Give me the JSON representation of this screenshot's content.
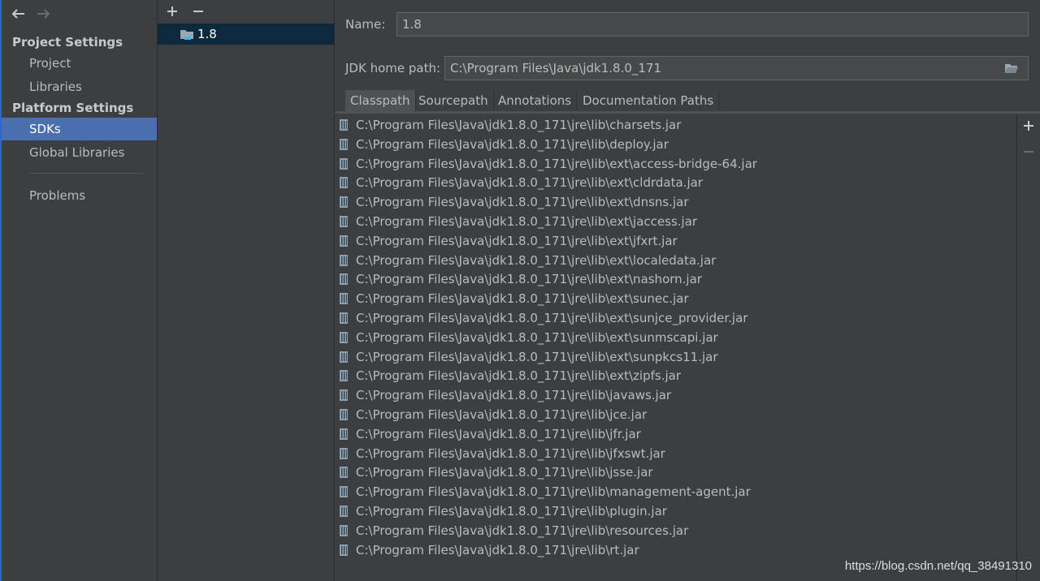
{
  "nav": {
    "back_icon": "back-arrow-icon",
    "forward_icon": "forward-arrow-icon",
    "project_settings_header": "Project Settings",
    "project_label": "Project",
    "libraries_label": "Libraries",
    "platform_settings_header": "Platform Settings",
    "sdks_label": "SDKs",
    "global_libraries_label": "Global Libraries",
    "problems_label": "Problems"
  },
  "sdk_list": {
    "add_icon": "plus-icon",
    "remove_icon": "minus-icon",
    "items": [
      {
        "label": "1.8",
        "icon": "sdk-folder-icon"
      }
    ]
  },
  "detail": {
    "name_label": "Name:",
    "name_value": "1.8",
    "jdk_home_label": "JDK home path:",
    "jdk_home_value": "C:\\Program Files\\Java\\jdk1.8.0_171",
    "browse_icon": "folder-open-icon",
    "tabs": [
      {
        "label": "Classpath",
        "active": true
      },
      {
        "label": "Sourcepath",
        "active": false
      },
      {
        "label": "Annotations",
        "active": false
      },
      {
        "label": "Documentation Paths",
        "active": false
      }
    ],
    "classpath": [
      "C:\\Program Files\\Java\\jdk1.8.0_171\\jre\\lib\\charsets.jar",
      "C:\\Program Files\\Java\\jdk1.8.0_171\\jre\\lib\\deploy.jar",
      "C:\\Program Files\\Java\\jdk1.8.0_171\\jre\\lib\\ext\\access-bridge-64.jar",
      "C:\\Program Files\\Java\\jdk1.8.0_171\\jre\\lib\\ext\\cldrdata.jar",
      "C:\\Program Files\\Java\\jdk1.8.0_171\\jre\\lib\\ext\\dnsns.jar",
      "C:\\Program Files\\Java\\jdk1.8.0_171\\jre\\lib\\ext\\jaccess.jar",
      "C:\\Program Files\\Java\\jdk1.8.0_171\\jre\\lib\\ext\\jfxrt.jar",
      "C:\\Program Files\\Java\\jdk1.8.0_171\\jre\\lib\\ext\\localedata.jar",
      "C:\\Program Files\\Java\\jdk1.8.0_171\\jre\\lib\\ext\\nashorn.jar",
      "C:\\Program Files\\Java\\jdk1.8.0_171\\jre\\lib\\ext\\sunec.jar",
      "C:\\Program Files\\Java\\jdk1.8.0_171\\jre\\lib\\ext\\sunjce_provider.jar",
      "C:\\Program Files\\Java\\jdk1.8.0_171\\jre\\lib\\ext\\sunmscapi.jar",
      "C:\\Program Files\\Java\\jdk1.8.0_171\\jre\\lib\\ext\\sunpkcs11.jar",
      "C:\\Program Files\\Java\\jdk1.8.0_171\\jre\\lib\\ext\\zipfs.jar",
      "C:\\Program Files\\Java\\jdk1.8.0_171\\jre\\lib\\javaws.jar",
      "C:\\Program Files\\Java\\jdk1.8.0_171\\jre\\lib\\jce.jar",
      "C:\\Program Files\\Java\\jdk1.8.0_171\\jre\\lib\\jfr.jar",
      "C:\\Program Files\\Java\\jdk1.8.0_171\\jre\\lib\\jfxswt.jar",
      "C:\\Program Files\\Java\\jdk1.8.0_171\\jre\\lib\\jsse.jar",
      "C:\\Program Files\\Java\\jdk1.8.0_171\\jre\\lib\\management-agent.jar",
      "C:\\Program Files\\Java\\jdk1.8.0_171\\jre\\lib\\plugin.jar",
      "C:\\Program Files\\Java\\jdk1.8.0_171\\jre\\lib\\resources.jar",
      "C:\\Program Files\\Java\\jdk1.8.0_171\\jre\\lib\\rt.jar"
    ],
    "jar_icon": "jar-file-icon",
    "add_icon": "plus-icon",
    "remove_icon": "minus-icon"
  },
  "watermark": "https://blog.csdn.net/qq_38491310",
  "colors": {
    "background": "#3c3f41",
    "selection": "#4b6eaf",
    "tree_selection": "#0d293e",
    "text": "#bbbbbb"
  }
}
